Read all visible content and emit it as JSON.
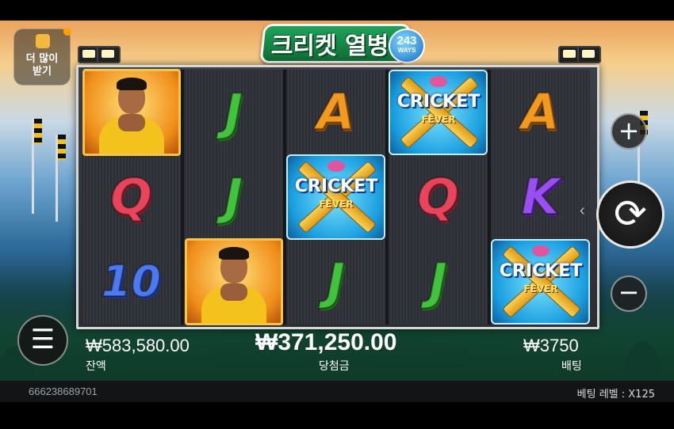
{
  "game": {
    "logo_text": "크리켓 열병",
    "ways_count": "243",
    "ways_label": "WAYS"
  },
  "more_button": {
    "label": "더 많이\n받기"
  },
  "reels": [
    [
      "portrait",
      "Q",
      "10"
    ],
    [
      "J",
      "J",
      "portrait"
    ],
    [
      "A",
      "wild",
      "J"
    ],
    [
      "wild",
      "Q",
      "J"
    ],
    [
      "A",
      "K",
      "wild"
    ]
  ],
  "symbols": {
    "wild_word": "CRICKET",
    "wild_sub": "FEVER"
  },
  "controls": {
    "plus_icon": "+",
    "minus_icon": "−",
    "spin_icon": "⟳",
    "menu_icon": "☰"
  },
  "stats": {
    "balance_value": "₩583,580.00",
    "balance_label": "잔액",
    "win_value": "₩371,250.00",
    "win_label": "당첨금",
    "bet_value": "₩3750",
    "bet_label": "배팅"
  },
  "footer": {
    "round_id": "666238689701",
    "bet_level_label": "베팅 레벨",
    "bet_level_value": "X125"
  }
}
